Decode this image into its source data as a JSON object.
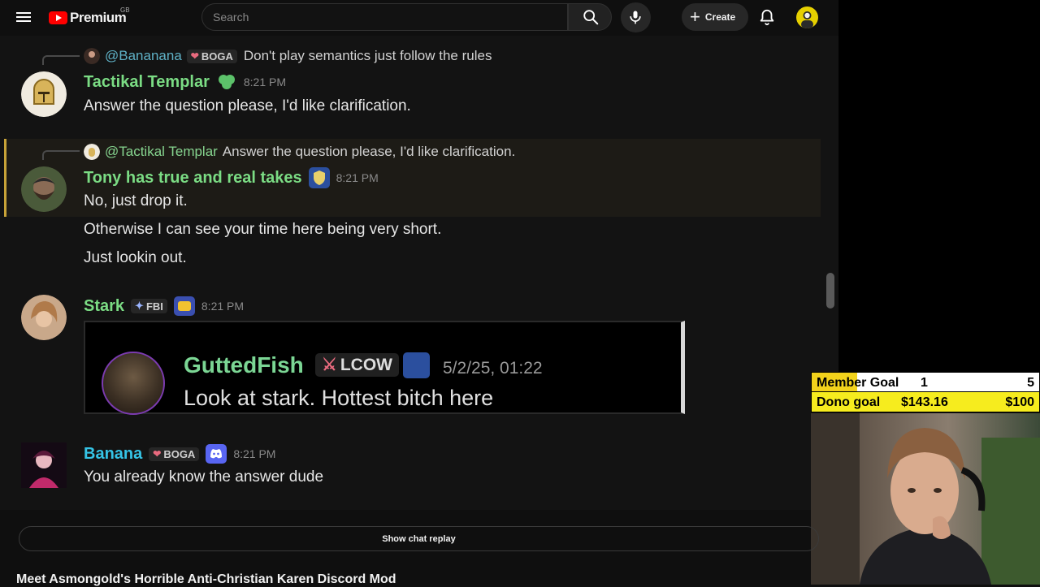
{
  "topbar": {
    "logo_text": "Premium",
    "logo_region": "GB",
    "search_placeholder": "Search",
    "create_label": "Create"
  },
  "chat": {
    "msg1": {
      "reply_mention": "@Bananana",
      "reply_tag": "BOGA",
      "reply_text": "Don't play semantics just follow the rules",
      "username": "Tactikal Templar",
      "time": "8:21 PM",
      "lines": [
        "Answer the question please, I'd like clarification."
      ]
    },
    "msg2": {
      "reply_mention": "@Tactikal Templar",
      "reply_text": "Answer the question please, I'd like clarification.",
      "username": "Tony has true and real takes",
      "time": "8:21 PM",
      "lines": [
        "No, just drop it.",
        "Otherwise I can see your time here being very short.",
        "Just lookin out."
      ]
    },
    "msg3": {
      "username": "Stark",
      "tag": "FBI",
      "time": "8:21 PM",
      "embed": {
        "username": "GuttedFish",
        "tag": "LCOW",
        "date": "5/2/25, 01:22",
        "text": "Look at stark. Hottest bitch here"
      }
    },
    "msg4": {
      "username": "Banana",
      "tag": "BOGA",
      "time": "8:21 PM",
      "lines": [
        "You already know the answer dude"
      ]
    }
  },
  "goals": {
    "member_label": "Member Goal",
    "member_current": "1",
    "member_target": "5",
    "member_progress": 0.2,
    "dono_label": "Dono goal",
    "dono_current": "$143.16",
    "dono_target": "$100"
  },
  "below": {
    "replay_label": "Show chat replay",
    "video_title": "Meet Asmongold's Horrible Anti-Christian Karen Discord Mod"
  },
  "colors": {
    "name_green": "#7bdc84",
    "name_blue": "#35c4e6",
    "mention_blue": "#5fb1c6",
    "youtube_red": "#ff0000",
    "highlight_gold": "#c8a338",
    "goal_yellow": "#f6ec1e"
  },
  "icons": {
    "menu": "hamburger-icon",
    "search": "search-icon",
    "mic": "microphone-icon",
    "create": "plus-icon",
    "notifications": "bell-icon",
    "discord": "discord-icon",
    "verified": "shield-badge-icon"
  }
}
